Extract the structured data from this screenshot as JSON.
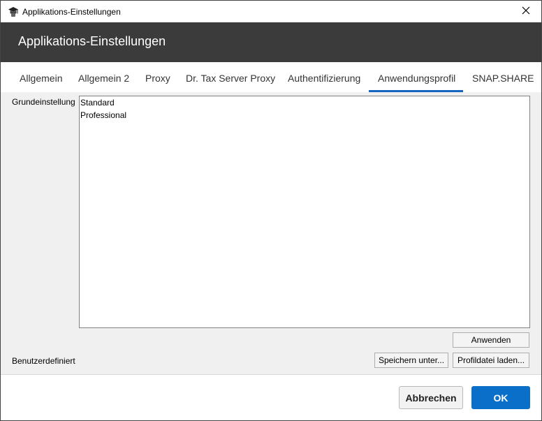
{
  "window": {
    "title": "Applikations-Einstellungen",
    "close_icon": "close-icon",
    "app_icon": "mortarboard-icon"
  },
  "header": {
    "title": "Applikations-Einstellungen"
  },
  "tabs": [
    {
      "label": "Allgemein",
      "active": false
    },
    {
      "label": "Allgemein 2",
      "active": false
    },
    {
      "label": "Proxy",
      "active": false
    },
    {
      "label": "Dr. Tax Server Proxy",
      "active": false
    },
    {
      "label": "Authentifizierung",
      "active": false
    },
    {
      "label": "Anwendungsprofil",
      "active": true
    },
    {
      "label": "SNAP.SHARE",
      "active": false
    }
  ],
  "profile": {
    "base_label": "Grundeinstellung",
    "base_options": [
      "Standard",
      "Professional"
    ],
    "apply_label": "Anwenden",
    "custom_label": "Benutzerdefiniert",
    "save_as_label": "Speichern unter...",
    "load_label": "Profildatei laden..."
  },
  "footer": {
    "cancel_label": "Abbrechen",
    "ok_label": "OK"
  },
  "colors": {
    "header_bg": "#3b3b3b",
    "accent": "#0a6fc9",
    "tab_underline": "#1565c0"
  }
}
